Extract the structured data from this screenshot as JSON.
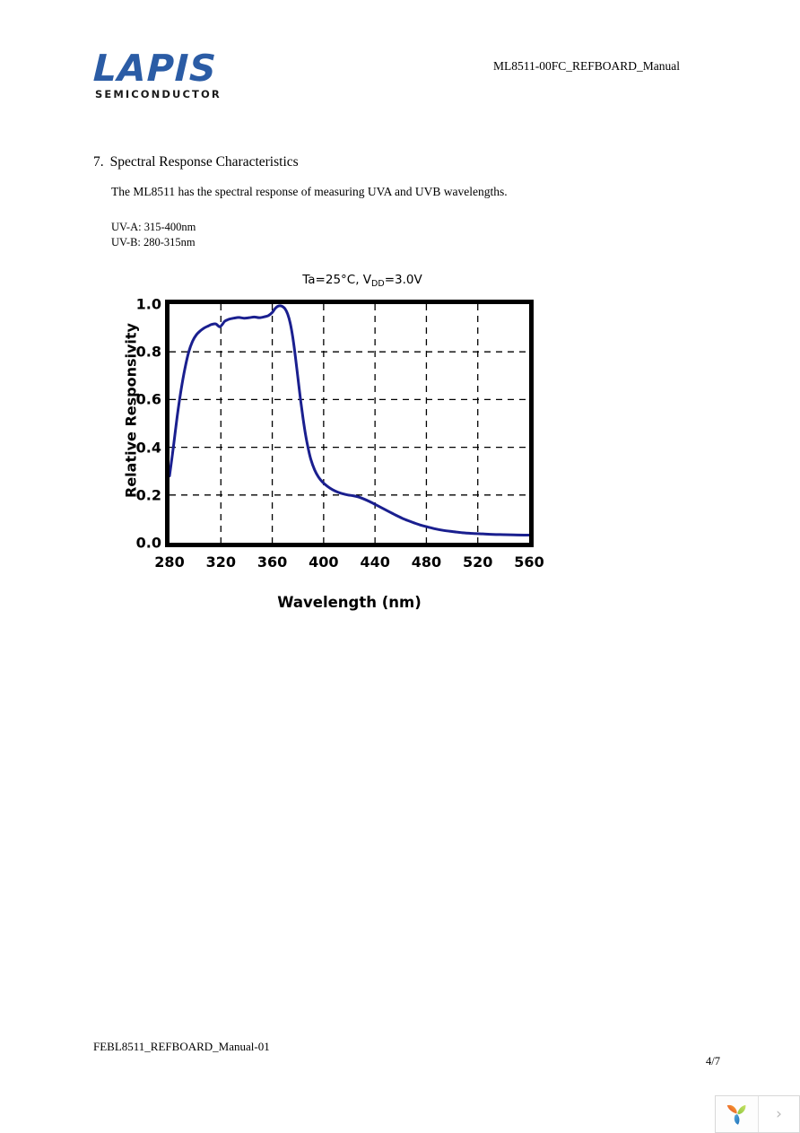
{
  "header": {
    "logo_wordmark": "LAPIS",
    "logo_subtext": "SEMICONDUCTOR",
    "logo_color": "#2b5ca5",
    "document_title": "ML8511-00FC_REFBOARD_Manual"
  },
  "content": {
    "section_number": "7.",
    "section_title": "Spectral Response Characteristics",
    "paragraph": "The ML8511 has the spectral response of measuring UVA and UVB wavelengths.",
    "uv_a_range": "UV-A: 315-400nm",
    "uv_b_range": "UV-B: 280-315nm"
  },
  "footer": {
    "document_id": "FEBL8511_REFBOARD_Manual-01",
    "page_number": "4/7"
  },
  "viewer": {
    "brand_icon": "leaf-logo-icon",
    "next_icon": "chevron-right-icon",
    "next_label": "›"
  },
  "chart_data": {
    "type": "line",
    "title": "Ta=25°C, V",
    "title_subscript": "DD",
    "title_suffix": "=3.0V",
    "xlabel": "Wavelength (nm)",
    "ylabel": "Relative Responsivity",
    "xlim": [
      280,
      560
    ],
    "ylim": [
      0.0,
      1.0
    ],
    "xticks": [
      280,
      320,
      360,
      400,
      440,
      480,
      520,
      560
    ],
    "yticks": [
      0.0,
      0.2,
      0.4,
      0.6,
      0.8,
      1.0
    ],
    "xtick_labels": [
      "280",
      "320",
      "360",
      "400",
      "440",
      "480",
      "520",
      "560"
    ],
    "ytick_labels": [
      "0.0",
      "0.2",
      "0.4",
      "0.6",
      "0.8",
      "1.0"
    ],
    "grid": "dashed-both",
    "gridlines_x": [
      320,
      360,
      400,
      440,
      480,
      520
    ],
    "gridlines_y": [
      0.2,
      0.4,
      0.6,
      0.8
    ],
    "legend": "none",
    "series": [
      {
        "name": "Relative Responsivity",
        "color": "#1a1f8f",
        "line_width": 3,
        "x": [
          280,
          283,
          286,
          289,
          292,
          295,
          298,
          301,
          304,
          307,
          310,
          313,
          316,
          319,
          321,
          323,
          326,
          330,
          334,
          338,
          342,
          346,
          350,
          354,
          357,
          360,
          362,
          364,
          366,
          368,
          370,
          372,
          374,
          376,
          378,
          380,
          382,
          384,
          386,
          388,
          390,
          393,
          396,
          399,
          403,
          407,
          411,
          415,
          419,
          423,
          427,
          431,
          436,
          441,
          446,
          451,
          456,
          461,
          466,
          471,
          476,
          481,
          487,
          493,
          500,
          508,
          516,
          524,
          532,
          540,
          548,
          556,
          560
        ],
        "y": [
          0.28,
          0.4,
          0.53,
          0.64,
          0.73,
          0.8,
          0.845,
          0.872,
          0.888,
          0.9,
          0.908,
          0.915,
          0.917,
          0.905,
          0.914,
          0.928,
          0.936,
          0.941,
          0.944,
          0.941,
          0.943,
          0.946,
          0.943,
          0.947,
          0.952,
          0.965,
          0.98,
          0.99,
          0.993,
          0.99,
          0.98,
          0.958,
          0.92,
          0.86,
          0.78,
          0.69,
          0.6,
          0.52,
          0.45,
          0.395,
          0.35,
          0.305,
          0.275,
          0.255,
          0.236,
          0.222,
          0.212,
          0.205,
          0.2,
          0.197,
          0.192,
          0.184,
          0.172,
          0.158,
          0.144,
          0.13,
          0.116,
          0.103,
          0.092,
          0.082,
          0.073,
          0.066,
          0.058,
          0.052,
          0.047,
          0.042,
          0.039,
          0.037,
          0.035,
          0.034,
          0.033,
          0.032,
          0.032
        ]
      }
    ]
  }
}
